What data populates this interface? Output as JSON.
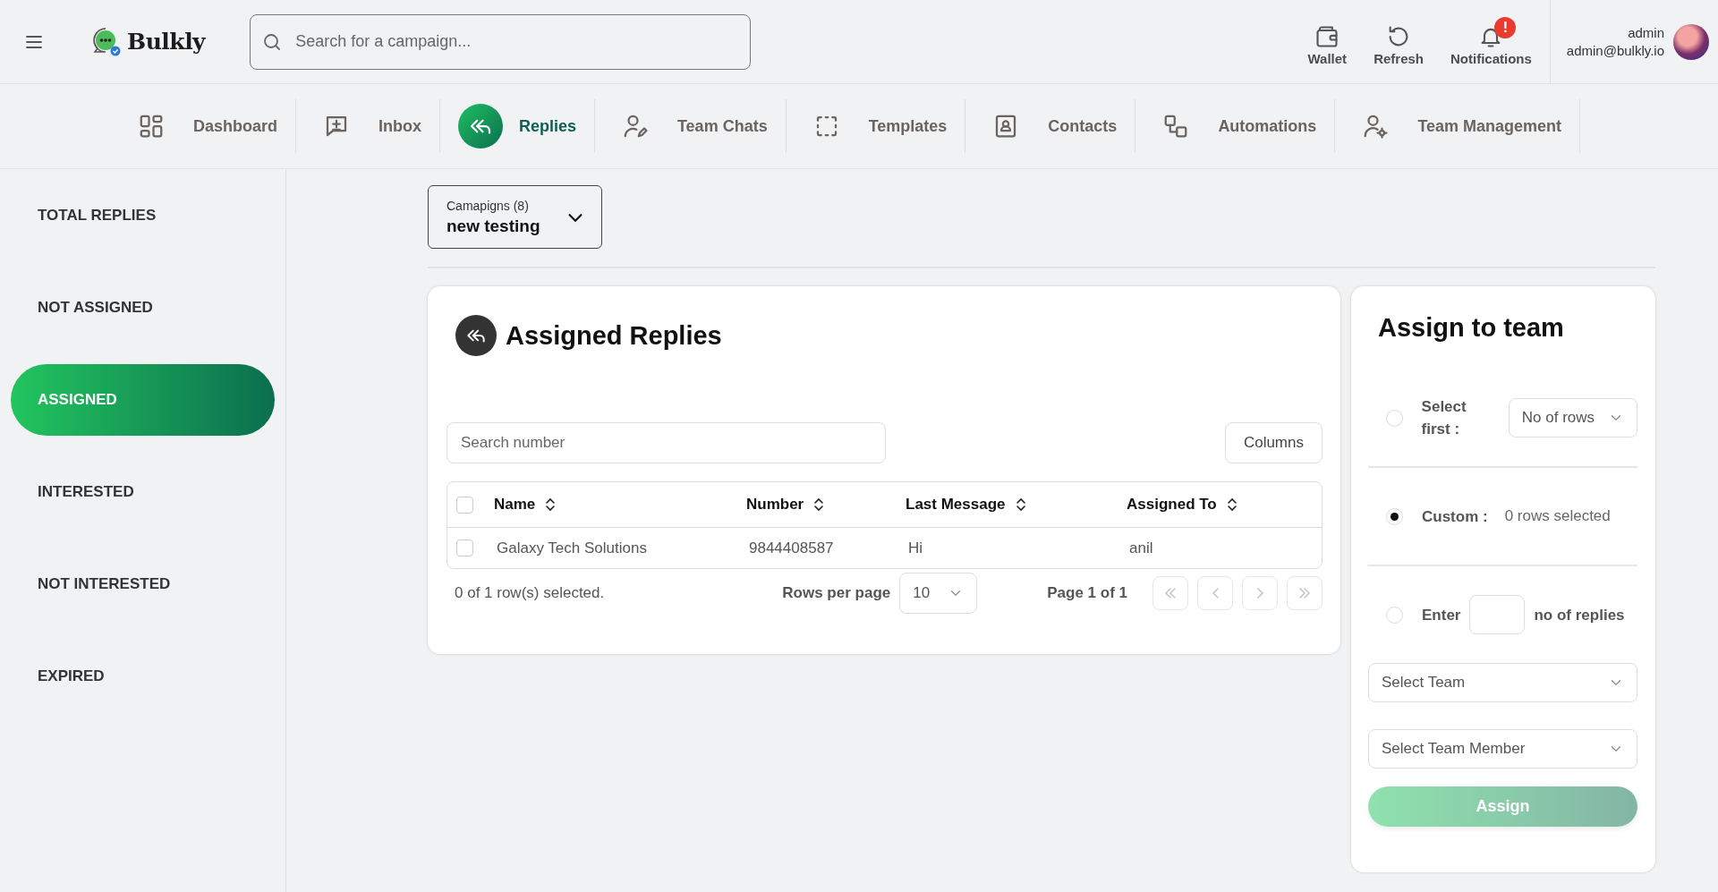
{
  "header": {
    "brand": "Bulkly",
    "search": {
      "placeholder": "Search for a campaign..."
    },
    "actions": [
      {
        "kind": "wallet",
        "label": "Wallet"
      },
      {
        "kind": "refresh",
        "label": "Refresh"
      },
      {
        "kind": "bell",
        "label": "Notifications",
        "badge": "!"
      }
    ],
    "user": {
      "name": "admin",
      "email": "admin@bulkly.io"
    }
  },
  "nav": [
    {
      "kind": "dashboard",
      "label": "Dashboard",
      "selected": false
    },
    {
      "kind": "inbox",
      "label": "Inbox",
      "selected": false
    },
    {
      "kind": "replies",
      "label": "Replies",
      "selected": true
    },
    {
      "kind": "chats",
      "label": "Team Chats",
      "selected": false
    },
    {
      "kind": "templates",
      "label": "Templates",
      "selected": false
    },
    {
      "kind": "contacts",
      "label": "Contacts",
      "selected": false
    },
    {
      "kind": "automations",
      "label": "Automations",
      "selected": false
    },
    {
      "kind": "team",
      "label": "Team Management",
      "selected": false
    }
  ],
  "sidebar": [
    {
      "label": "TOTAL REPLIES",
      "selected": false
    },
    {
      "label": "NOT ASSIGNED",
      "selected": false
    },
    {
      "label": "ASSIGNED",
      "selected": true
    },
    {
      "label": "INTERESTED",
      "selected": false
    },
    {
      "label": "NOT INTERESTED",
      "selected": false
    },
    {
      "label": "EXPIRED",
      "selected": false
    }
  ],
  "campaign_select": {
    "label": "Camapigns (8)",
    "value": "new testing"
  },
  "replies": {
    "title": "Assigned Replies",
    "search": {
      "placeholder": "Search number"
    },
    "columns_button": "Columns",
    "table": {
      "all_checked": false,
      "columns": [
        "Name",
        "Number",
        "Last Message",
        "Assigned To"
      ],
      "rows": [
        {
          "checked": false,
          "cells": [
            "Galaxy Tech Solutions",
            "9844408587",
            "Hi",
            "anil"
          ]
        }
      ]
    },
    "selection_note": "0 of 1 row(s) selected.",
    "rows_per_page": {
      "label": "Rows per page",
      "value": "10"
    },
    "page": "Page 1 of 1",
    "pager": [
      {
        "kind": "first",
        "disabled": true
      },
      {
        "kind": "prev",
        "disabled": true
      },
      {
        "kind": "next",
        "disabled": true
      },
      {
        "kind": "last",
        "disabled": true
      }
    ]
  },
  "assign": {
    "title": "Assign to team",
    "options": [
      {
        "kind": "select_first",
        "label": "Select first :",
        "selected": false,
        "placeholder": "No of rows"
      },
      {
        "kind": "custom",
        "label": "Custom :",
        "selected": true,
        "note": "0 rows selected"
      },
      {
        "kind": "enter",
        "label": "Enter",
        "selected": false,
        "suffix": "no of replies"
      }
    ],
    "team_select": {
      "placeholder": "Select Team"
    },
    "member_select": {
      "placeholder": "Select Team Member"
    },
    "assign_button": {
      "label": "Assign",
      "disabled": true
    }
  }
}
